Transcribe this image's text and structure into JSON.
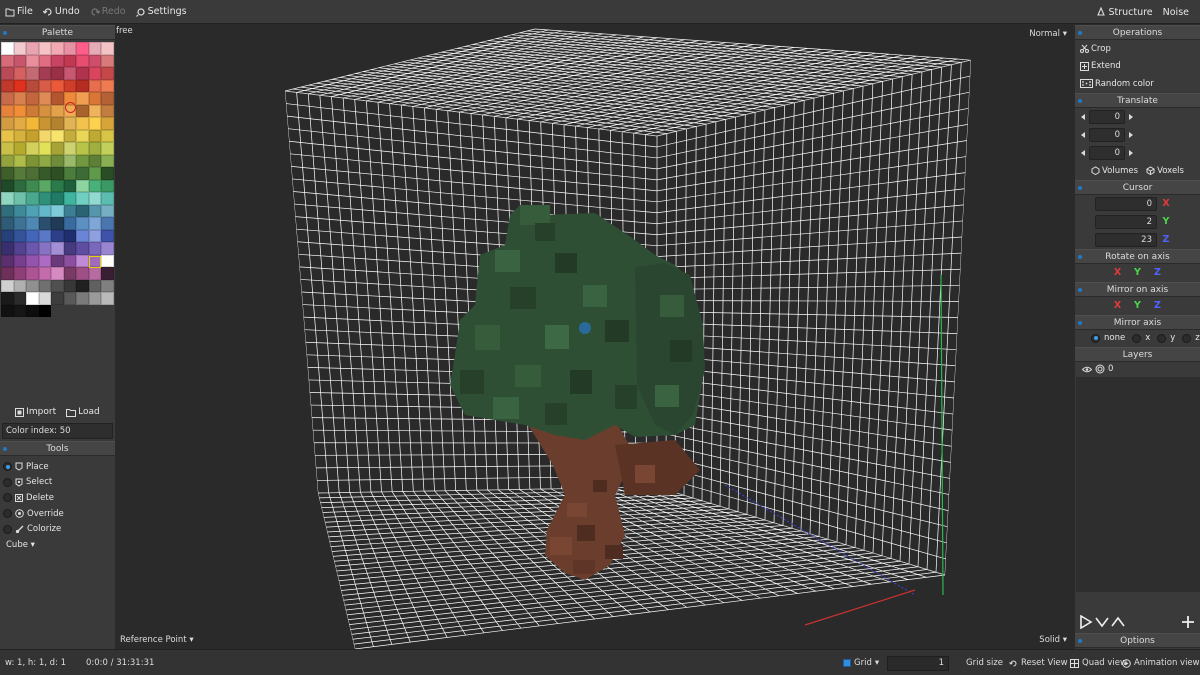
{
  "menu": {
    "file": "File",
    "undo": "Undo",
    "redo": "Redo",
    "settings": "Settings",
    "structure": "Structure",
    "noise": "Noise"
  },
  "left_panel": {
    "palette_title": "Palette",
    "palette_colors": [
      "#ffffff",
      "#f2c9cf",
      "#e9a4b2",
      "#f5c3c6",
      "#f2a9b1",
      "#e891a4",
      "#ff5d8a",
      "#e7aab7",
      "#f4c3c5",
      "#d86b78",
      "#c7566d",
      "#e98e9b",
      "#e06d82",
      "#c94462",
      "#c03852",
      "#e64d6f",
      "#cf4e6b",
      "#d97a7a",
      "#b94a56",
      "#d46060",
      "#c46a73",
      "#a43d53",
      "#9b2f43",
      "#c75773",
      "#b0334d",
      "#d8455c",
      "#c44848",
      "#c0392b",
      "#e0301e",
      "#b74a3a",
      "#d95c48",
      "#ea5a3a",
      "#cf3e28",
      "#b52d22",
      "#e66d4d",
      "#ef7b52",
      "#c96a4a",
      "#d9804f",
      "#c2663d",
      "#e08a55",
      "#b3562f",
      "#ef8a3d",
      "#f29e50",
      "#d97535",
      "#b46136",
      "#e6823c",
      "#f08f38",
      "#cc7a34",
      "#d6913e",
      "#e5a04c",
      "#f2ab55",
      "#a8642c",
      "#f0b25b",
      "#c27d3f",
      "#d39b42",
      "#e4aa45",
      "#f4b838",
      "#c99432",
      "#b3832f",
      "#e0b354",
      "#f2c24d",
      "#fcd14e",
      "#d6a43a",
      "#e8c34a",
      "#d5b13e",
      "#c6a02c",
      "#f4d76a",
      "#f8e36d",
      "#c4ad3a",
      "#e9d658",
      "#bfa933",
      "#d8c548",
      "#c9c04a",
      "#b3aa2e",
      "#d3d05c",
      "#e2e258",
      "#a7a337",
      "#cfd36f",
      "#b8c447",
      "#9fb03e",
      "#c2cf5a",
      "#92a33d",
      "#aebc4a",
      "#7e9434",
      "#8fa944",
      "#6f8c3a",
      "#9bb96a",
      "#72983f",
      "#5e8036",
      "#8aae52",
      "#3f5f2a",
      "#557a3a",
      "#4d6e34",
      "#365b2a",
      "#2e4e24",
      "#4c7d3d",
      "#3d6b35",
      "#5f9a4a",
      "#294d24",
      "#1f4a2a",
      "#2d6b3e",
      "#3f8a50",
      "#5aa864",
      "#2a7a4a",
      "#1f5f3c",
      "#8ed4a0",
      "#49b07a",
      "#3b9966",
      "#8fd6c0",
      "#6fc2aa",
      "#4aa88f",
      "#2f8f78",
      "#1f7a66",
      "#3fb5a0",
      "#6fd0c2",
      "#92d9d0",
      "#5cbcb0",
      "#2f6e7a",
      "#3e8a99",
      "#4ea2b3",
      "#63b9c9",
      "#7fcad8",
      "#3c7f92",
      "#2a6374",
      "#5596ad",
      "#76aec4",
      "#2d5b78",
      "#3f7396",
      "#4f88b3",
      "#2a4f6e",
      "#1f3b56",
      "#3a6b9e",
      "#5c8fc2",
      "#7ea6d6",
      "#4a76b0",
      "#26407a",
      "#34549a",
      "#4466b8",
      "#5a78c8",
      "#2e3f8a",
      "#1f2e6e",
      "#6b85d6",
      "#8ea0e0",
      "#3d52a8",
      "#3a2f6e",
      "#52428f",
      "#6b58ad",
      "#8872c4",
      "#a28fd6",
      "#463a80",
      "#5e4da0",
      "#7a68bd",
      "#9a86d0",
      "#5b2f6e",
      "#783f8f",
      "#9454ad",
      "#ad6bc4",
      "#6b3a7a",
      "#8a4f9e",
      "#c08ad6",
      "#a26bb8",
      "#ffffff",
      "#6e2f5b",
      "#8f3f78",
      "#ad5494",
      "#c46bad",
      "#d68ac2",
      "#7a3a66",
      "#9e4f86",
      "#b86ba0",
      "#3a1f33",
      "#d0d0d0",
      "#b0b0b0",
      "#909090",
      "#707070",
      "#505050",
      "#383838",
      "#202020",
      "#606060",
      "#808080",
      "#1a1a1a",
      "#2b2b2b",
      "#ffffff",
      "#d9d9d9",
      "#3d3d3d",
      "#595959",
      "#7a7a7a",
      "#9a9a9a",
      "#bababa",
      "#111111",
      "#161616",
      "#0d0d0d",
      "#000000"
    ],
    "import_label": "Import",
    "load_label": "Load",
    "color_index_label": "Color index: 50",
    "tools_title": "Tools",
    "tools": [
      {
        "label": "Place",
        "selected": true
      },
      {
        "label": "Select",
        "selected": false
      },
      {
        "label": "Delete",
        "selected": false
      },
      {
        "label": "Override",
        "selected": false
      },
      {
        "label": "Colorize",
        "selected": false
      }
    ],
    "brush_shape": "Cube"
  },
  "viewport": {
    "camera_mode": "free",
    "render_mode": "Normal",
    "reference_point": "Reference Point",
    "shading": "Solid"
  },
  "right_panel": {
    "operations_title": "Operations",
    "operations": [
      "Crop",
      "Extend",
      "Random color"
    ],
    "translate_title": "Translate",
    "translate_values": [
      "0",
      "0",
      "0"
    ],
    "volumes_label": "Volumes",
    "voxels_label": "Voxels",
    "cursor_title": "Cursor",
    "cursor": [
      {
        "value": "0",
        "axis": "X"
      },
      {
        "value": "2",
        "axis": "Y"
      },
      {
        "value": "23",
        "axis": "Z"
      }
    ],
    "rotate_title": "Rotate on axis",
    "mirror_on_axis_title": "Mirror on axis",
    "axes": [
      "X",
      "Y",
      "Z"
    ],
    "mirror_axis_title": "Mirror axis",
    "mirror_axis_options": [
      "none",
      "x",
      "y",
      "z"
    ],
    "mirror_axis_selected": "none",
    "layers_title": "Layers",
    "layers": [
      {
        "name": "0",
        "visible": true
      }
    ],
    "options_title": "Options"
  },
  "statusbar": {
    "dimensions": "w: 1, h: 1, d: 1",
    "position": "0:0:0 / 31:31:31",
    "grid_label": "Grid",
    "grid_size_value": "1",
    "grid_size_label": "Grid size",
    "reset_view": "Reset View",
    "quad_view": "Quad view",
    "animation_view": "Animation view"
  },
  "colors": {
    "accent": "#1e7ac9",
    "panel": "#3a3a3a",
    "grid_line": "#ffffff",
    "foliage": "#2f4f35",
    "trunk": "#6b3d2c",
    "axis_x": "#e23b3b",
    "axis_y": "#4cd64c",
    "axis_z": "#4f64ff"
  }
}
